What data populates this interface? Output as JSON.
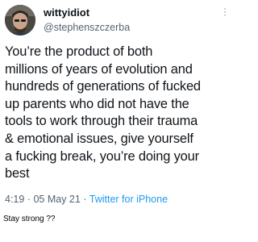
{
  "tweet": {
    "display_name": "wittyidiot",
    "handle": "@stephenszczerba",
    "text": "You’re the product of both\nmillions of years of evolution and\nhundreds of generations of fucked\nup parents who did not have the\ntools to work through their trauma\n& emotional issues, give yourself\na fucking break, you’re doing your\nbest",
    "time": "4:19",
    "date": "05 May 21",
    "source": "Twitter for iPhone",
    "avatar_icon": "profile-photo",
    "more_icon": "vertical-ellipsis-icon"
  },
  "caption": "Stay strong ??",
  "colors": {
    "text": "#0f1419",
    "secondary": "#536471",
    "link": "#1d9bf0"
  }
}
